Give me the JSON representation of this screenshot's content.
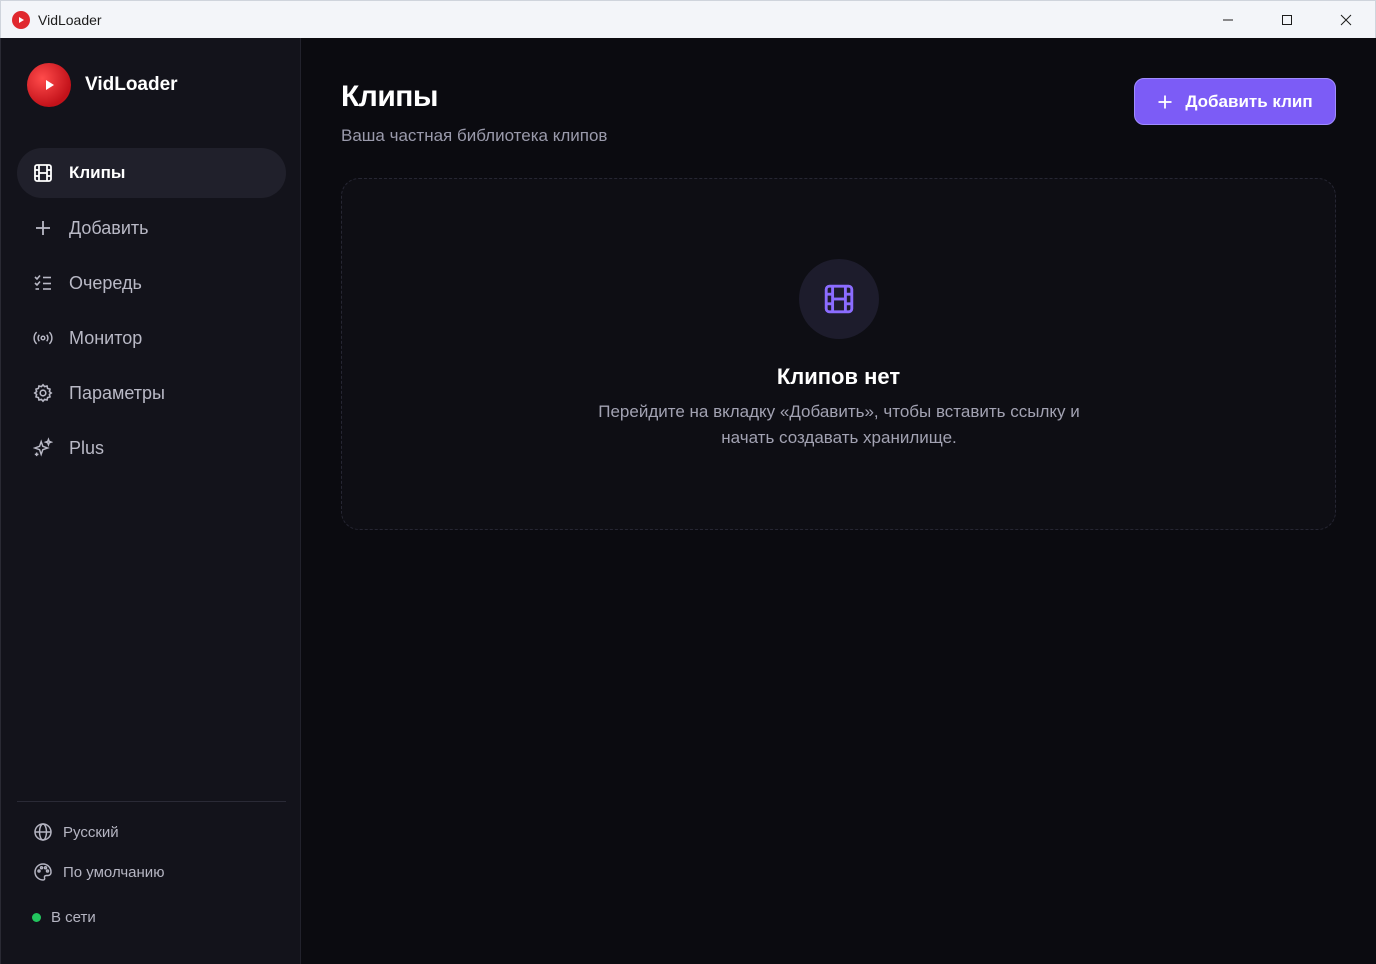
{
  "window": {
    "title": "VidLoader"
  },
  "sidebar": {
    "brand": "VidLoader",
    "items": [
      {
        "label": "Клипы",
        "icon": "film-icon",
        "active": true
      },
      {
        "label": "Добавить",
        "icon": "plus-icon",
        "active": false
      },
      {
        "label": "Очередь",
        "icon": "list-check-icon",
        "active": false
      },
      {
        "label": "Монитор",
        "icon": "radio-broadcast-icon",
        "active": false
      },
      {
        "label": "Параметры",
        "icon": "gear-icon",
        "active": false
      },
      {
        "label": "Plus",
        "icon": "sparkles-icon",
        "active": false
      }
    ],
    "footer": {
      "language": "Русский",
      "theme": "По умолчанию",
      "status": "В сети"
    }
  },
  "main": {
    "title": "Клипы",
    "subtitle": "Ваша частная библиотека клипов",
    "add_button": "Добавить клип",
    "empty_state": {
      "title": "Клипов нет",
      "description": "Перейдите на вкладку «Добавить», чтобы вставить ссылку и начать создавать хранилище."
    }
  },
  "colors": {
    "accent": "#7c5cf6",
    "brand_red": "#e0282e",
    "status_online": "#22c55e",
    "sidebar_bg": "#13131b",
    "main_bg": "#0b0b10"
  }
}
